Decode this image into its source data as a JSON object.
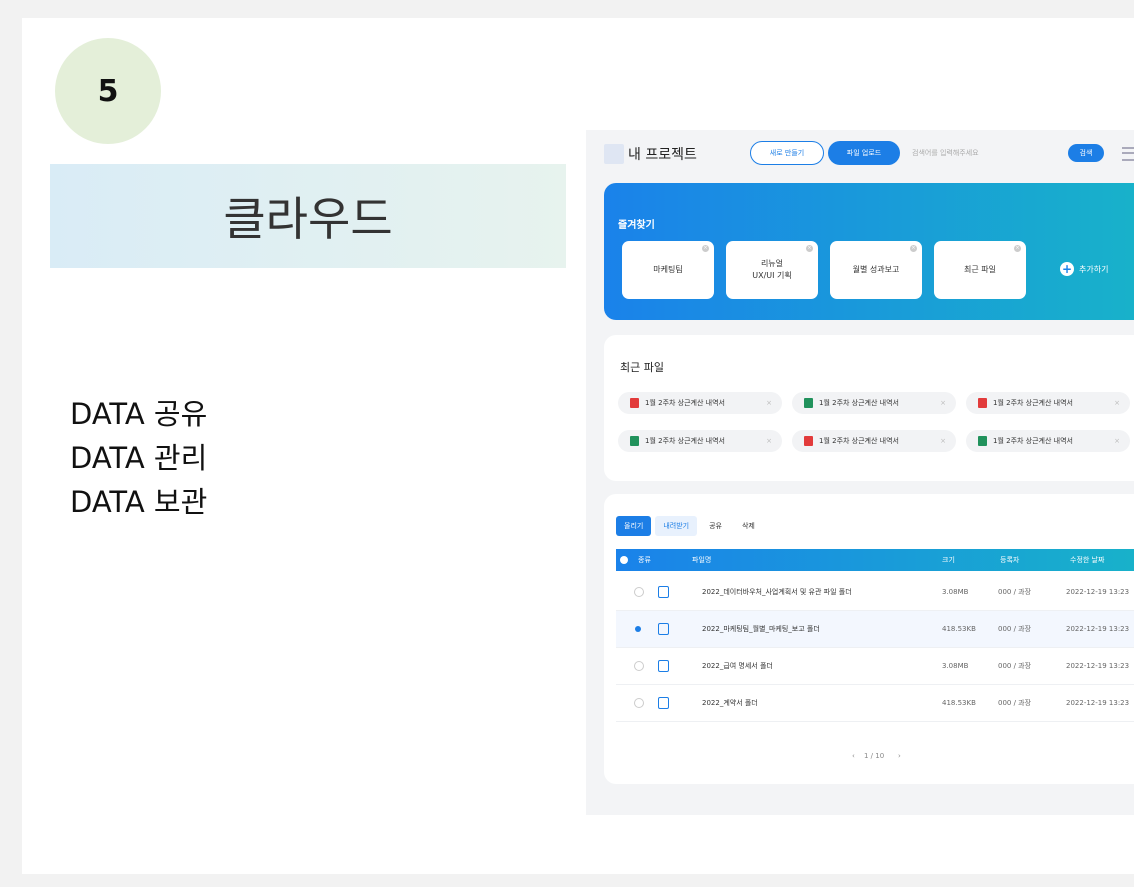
{
  "slide": {
    "number": "5",
    "title": "클라우드",
    "bullets": [
      "DATA 공유",
      "DATA 관리",
      "DATA 보관"
    ]
  },
  "app": {
    "project_title": "내 프로젝트",
    "new_button": "새로 만들기",
    "upload_button": "파일 업로드",
    "search_placeholder": "검색어를 입력해주세요",
    "search_button": "검색"
  },
  "favorites": {
    "label": "즐겨찾기",
    "items": [
      "마케팅팀",
      "리뉴얼\nUX/UI 기획",
      "월별 성과보고",
      "최근 파일"
    ],
    "add_label": "추가하기"
  },
  "recent": {
    "label": "최근 파일",
    "files": [
      {
        "name": "1월 2주차 상근계산 내역서",
        "type": "pdf"
      },
      {
        "name": "1월 2주차 상근계산 내역서",
        "type": "xls"
      },
      {
        "name": "1월 2주차 상근계산 내역서",
        "type": "pdf"
      },
      {
        "name": "1월 2주차 상근계산 내역서",
        "type": "xls"
      },
      {
        "name": "1월 2주차 상근계산 내역서",
        "type": "pdf"
      },
      {
        "name": "1월 2주차 상근계산 내역서",
        "type": "xls"
      }
    ]
  },
  "file_list": {
    "tabs": [
      "올리기",
      "내려받기",
      "공유",
      "삭제"
    ],
    "headers": {
      "type": "종류",
      "name": "파일명",
      "size": "크기",
      "owner": "등록자",
      "date": "수정한 날짜"
    },
    "rows": [
      {
        "name": "2022_데이터바우처_사업계획서 및 유관 파일 폴더",
        "size": "3.08MB",
        "owner": "000 / 과장",
        "date": "2022-12-19 13:23",
        "selected": false
      },
      {
        "name": "2022_마케팅팀_월별_마케팅_보고 폴더",
        "size": "418.53KB",
        "owner": "000 / 과장",
        "date": "2022-12-19 13:23",
        "selected": true
      },
      {
        "name": "2022_급여 명세서 폴더",
        "size": "3.08MB",
        "owner": "000 / 과장",
        "date": "2022-12-19 13:23",
        "selected": false
      },
      {
        "name": "2022_계약서 폴더",
        "size": "418.53KB",
        "owner": "000 / 과장",
        "date": "2022-12-19 13:23",
        "selected": false
      }
    ],
    "pagination": "1 / 10"
  },
  "colors": {
    "accent": "#1c7ee6",
    "pdf": "#e23b3b",
    "xls": "#21925c"
  }
}
